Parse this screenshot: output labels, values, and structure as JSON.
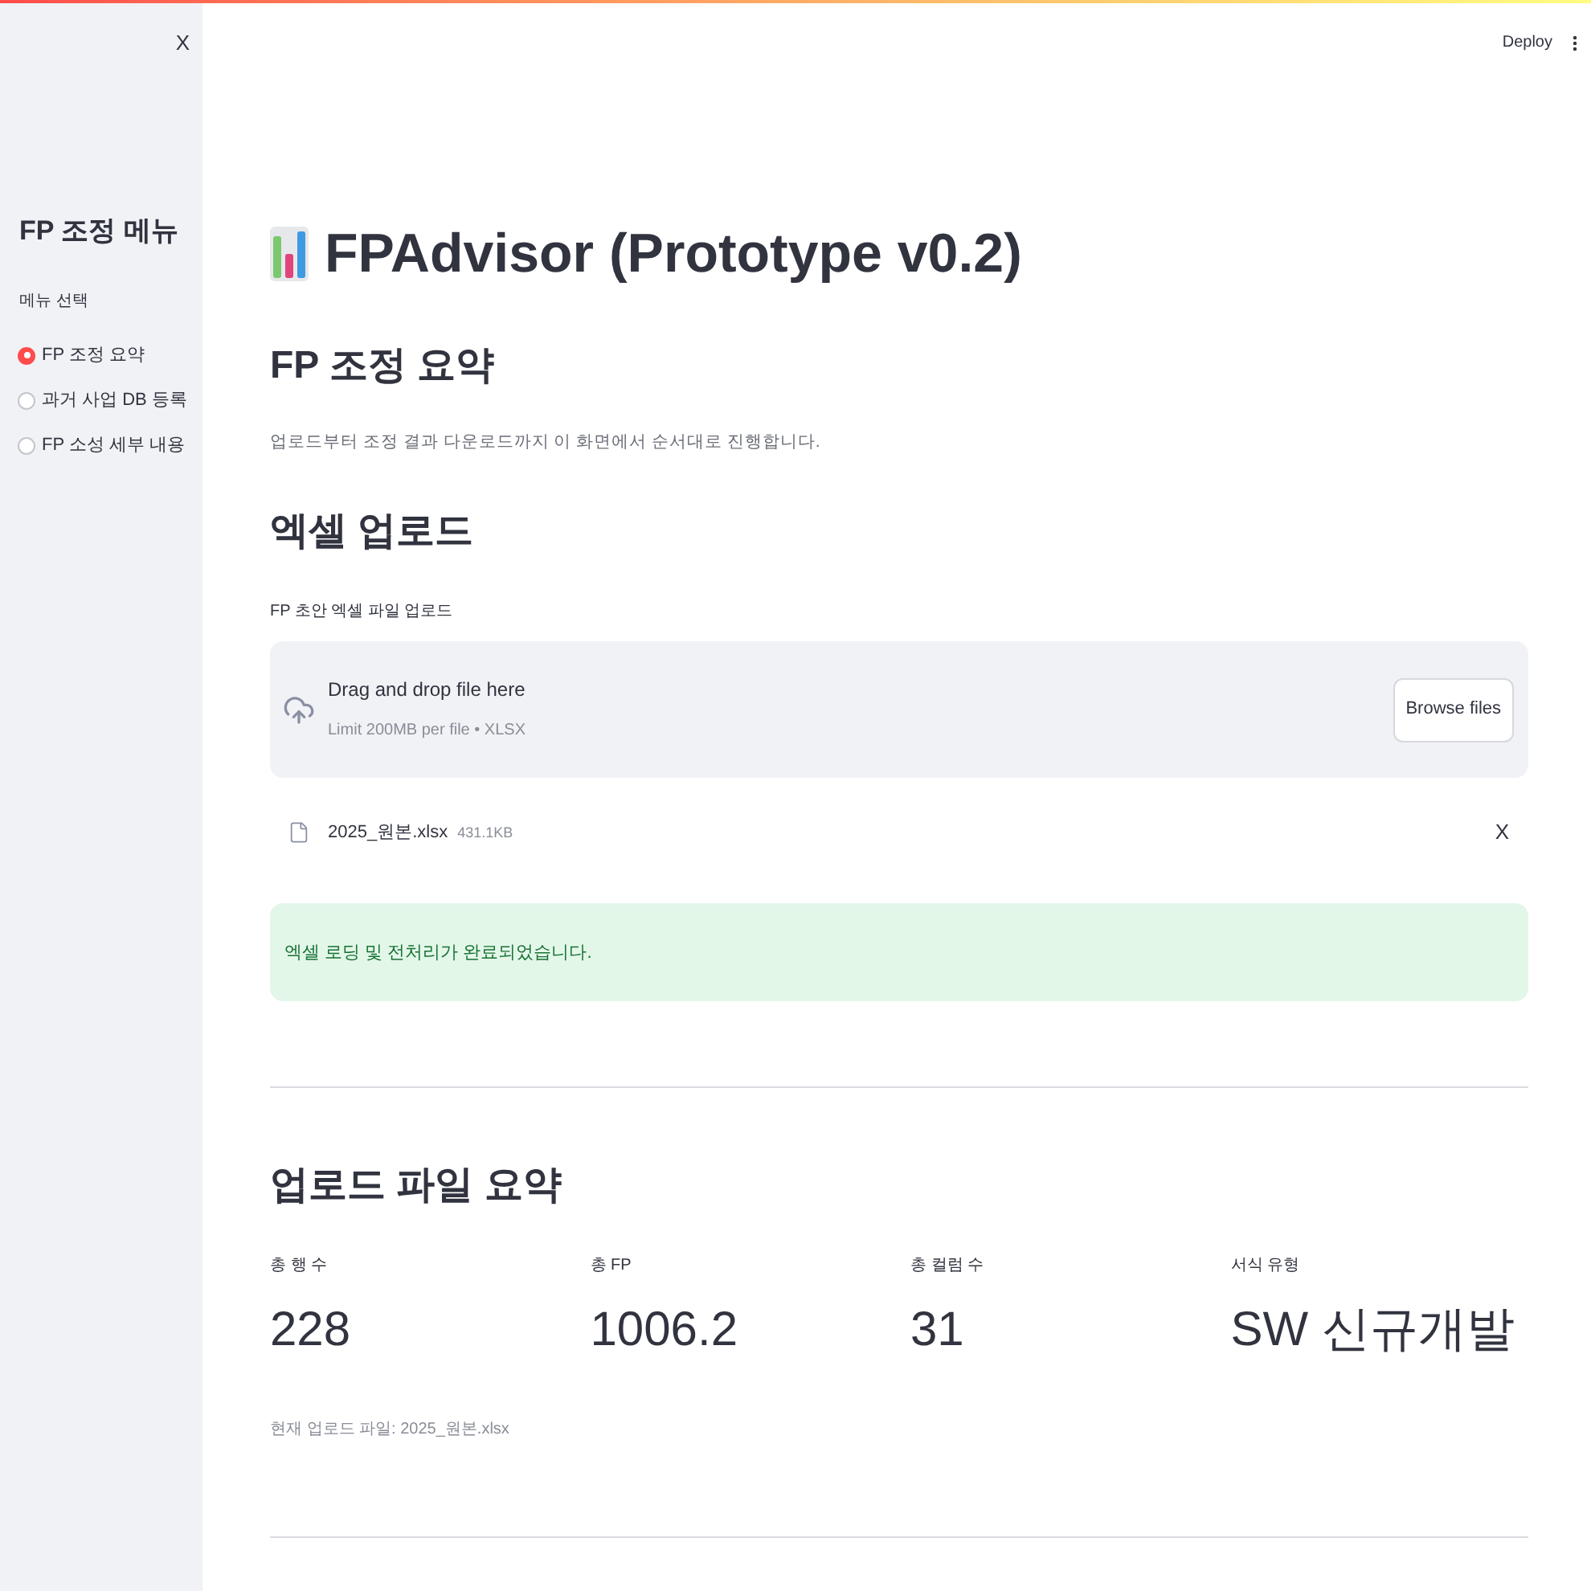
{
  "header": {
    "deploy": "Deploy"
  },
  "sidebar": {
    "close": "X",
    "title": "FP 조정 메뉴",
    "radio_label": "메뉴 선택",
    "options": [
      {
        "label": "FP 조정 요약",
        "selected": true
      },
      {
        "label": "과거 사업 DB 등록",
        "selected": false
      },
      {
        "label": "FP 소성 세부 내용",
        "selected": false
      }
    ]
  },
  "main": {
    "title": "FPAdvisor (Prototype v0.2)",
    "heading": "FP 조정 요약",
    "description": "업로드부터 조정 결과 다운로드까지 이 화면에서 순서대로 진행합니다.",
    "upload_heading": "엑셀 업로드",
    "uploader": {
      "label": "FP 초안 엑셀 파일 업로드",
      "drop_text": "Drag and drop file here",
      "limit_text": "Limit 200MB per file • XLSX",
      "button": "Browse files"
    },
    "file": {
      "name": "2025_원본.xlsx",
      "size": "431.1KB",
      "remove": "X"
    },
    "alert": {
      "kind": "success",
      "text": "엑셀 로딩 및 전처리가 완료되었습니다."
    },
    "summary_heading": "업로드 파일 요약",
    "metrics": [
      {
        "label": "총 행 수",
        "value": "228"
      },
      {
        "label": "총 FP",
        "value": "1006.2"
      },
      {
        "label": "총 컬럼 수",
        "value": "31"
      },
      {
        "label": "서식 유형",
        "value": "SW 신규개발"
      }
    ],
    "footnote": "현재 업로드 파일: 2025_원본.xlsx"
  }
}
